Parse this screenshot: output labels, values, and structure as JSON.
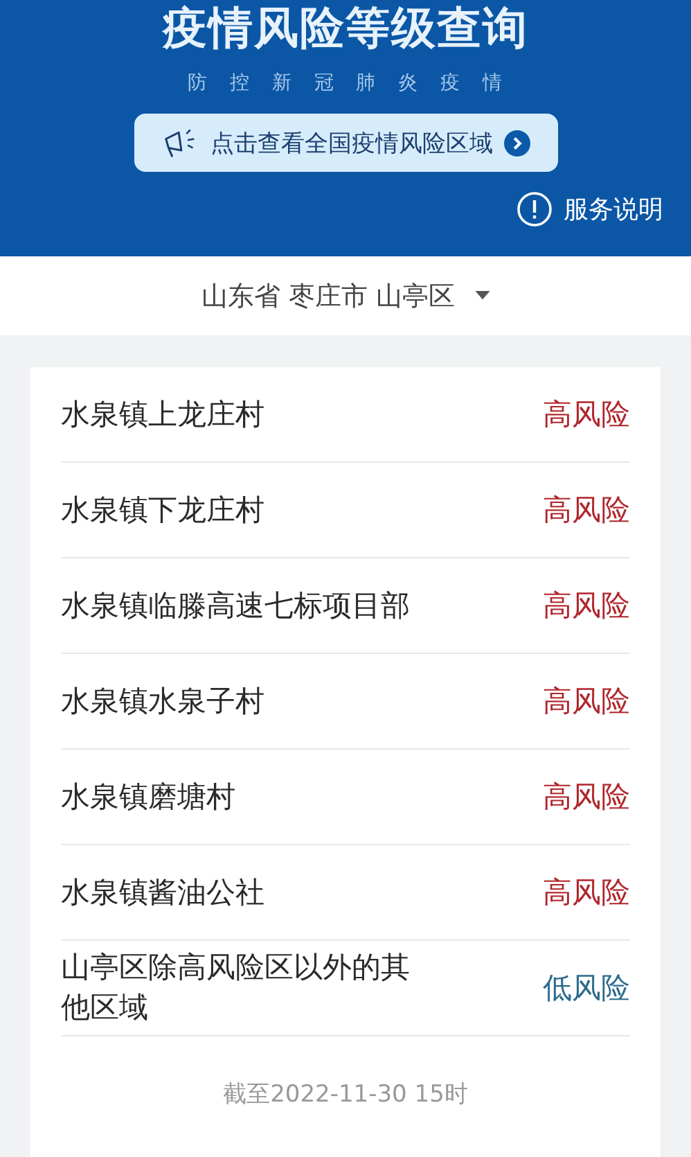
{
  "header": {
    "title": "疫情风险等级查询",
    "subtitle": "防 控 新 冠 肺 炎 疫 情",
    "banner_button": "点击查看全国疫情风险区域",
    "service_link": "服务说明"
  },
  "location": {
    "province": "山东省",
    "city": "枣庄市",
    "district": "山亭区"
  },
  "areas": [
    {
      "name": "水泉镇上龙庄村",
      "kind": "high",
      "label": "高风险"
    },
    {
      "name": "水泉镇下龙庄村",
      "kind": "high",
      "label": "高风险"
    },
    {
      "name": "水泉镇临滕高速七标项目部",
      "kind": "high",
      "label": "高风险"
    },
    {
      "name": "水泉镇水泉子村",
      "kind": "high",
      "label": "高风险"
    },
    {
      "name": "水泉镇磨塘村",
      "kind": "high",
      "label": "高风险"
    },
    {
      "name": "水泉镇酱油公社",
      "kind": "high",
      "label": "高风险"
    },
    {
      "name": "山亭区除高风险区以外的其他区域",
      "kind": "low",
      "label": "低风险"
    }
  ],
  "updated": "截至2022-11-30 15时"
}
